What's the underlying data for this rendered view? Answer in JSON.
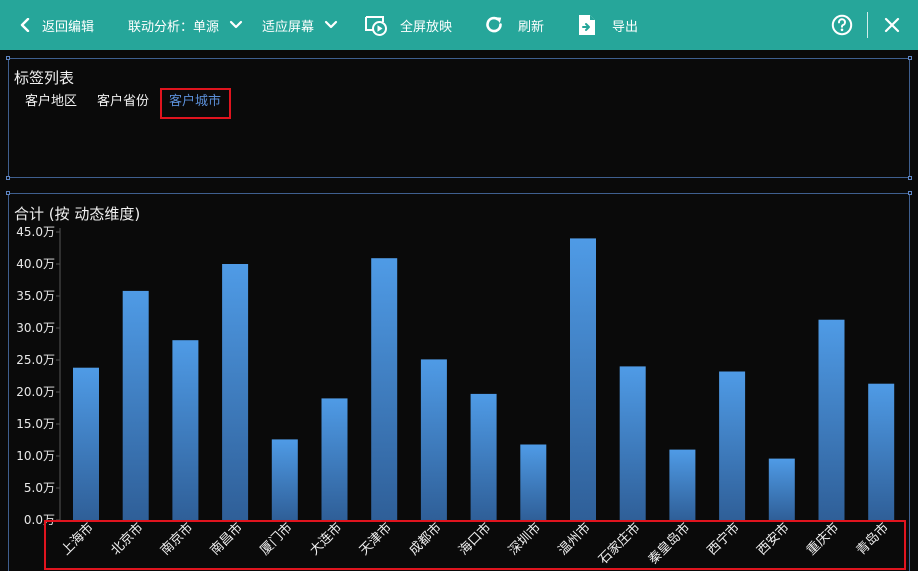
{
  "toolbar": {
    "back_label": "返回编辑",
    "linkage_label": "联动分析：单源",
    "fit_label": "适应屏幕",
    "fullscreen_label": "全屏放映",
    "refresh_label": "刷新",
    "export_label": "导出"
  },
  "tag_panel": {
    "title": "标签列表",
    "tags": [
      "客户地区",
      "客户省份",
      "客户城市"
    ],
    "active_index": 2
  },
  "chart_panel": {
    "title": "合计 (按 动态维度)"
  },
  "colors": {
    "toolbar_bg": "#26a69a",
    "bar_top": "#4f9be6",
    "bar_bottom": "#2f5f98",
    "active_tag": "#5b8fd8",
    "highlight": "#e0141e"
  },
  "chart_data": {
    "type": "bar",
    "categories": [
      "上海市",
      "北京市",
      "南京市",
      "南昌市",
      "厦门市",
      "大连市",
      "天津市",
      "成都市",
      "海口市",
      "深圳市",
      "温州市",
      "石家庄市",
      "秦皇岛市",
      "西宁市",
      "西安市",
      "重庆市",
      "青岛市"
    ],
    "values": [
      23.8,
      35.8,
      28.1,
      40.0,
      12.6,
      19.0,
      40.9,
      25.1,
      19.7,
      11.8,
      44.0,
      24.0,
      11.0,
      23.2,
      9.6,
      31.3,
      21.3
    ],
    "yticks": [
      "0.0万",
      "5.0万",
      "10.0万",
      "15.0万",
      "20.0万",
      "25.0万",
      "30.0万",
      "35.0万",
      "40.0万",
      "45.0万"
    ],
    "ylim": [
      0,
      45
    ],
    "grid": false,
    "legend": "none"
  }
}
